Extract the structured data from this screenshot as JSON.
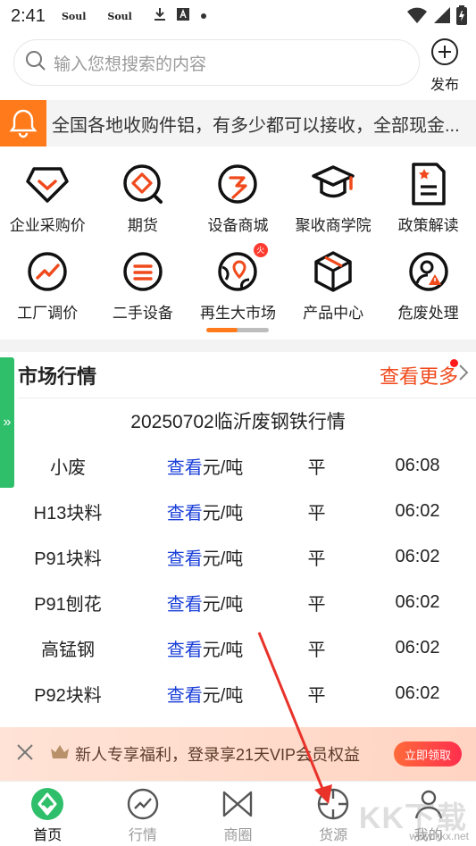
{
  "status_bar": {
    "time": "2:41",
    "app_icons": [
      "Soul",
      "Soul"
    ]
  },
  "search": {
    "placeholder": "输入您想搜索的内容",
    "publish_label": "发布"
  },
  "notice": {
    "text": "全国各地收购件铝，有多少都可以接收，全部现金..."
  },
  "grid": {
    "row1": [
      {
        "label": "企业采购价",
        "icon": "pentagon-check-icon"
      },
      {
        "label": "期货",
        "icon": "diamond-search-icon"
      },
      {
        "label": "设备商城",
        "icon": "bolt-circle-icon"
      },
      {
        "label": "聚收商学院",
        "icon": "graduation-cap-icon"
      },
      {
        "label": "政策解读",
        "icon": "document-star-icon"
      }
    ],
    "row2": [
      {
        "label": "工厂调价",
        "icon": "trend-circle-icon"
      },
      {
        "label": "二手设备",
        "icon": "menu-circle-icon"
      },
      {
        "label": "再生大市场",
        "icon": "map-pin-icon",
        "badge": "火"
      },
      {
        "label": "产品中心",
        "icon": "cube-icon"
      },
      {
        "label": "危废处理",
        "icon": "person-warning-icon"
      }
    ],
    "page_indicator": 0.5
  },
  "market": {
    "title": "市场行情",
    "more_label": "查看更多",
    "subtitle": "20250702临沂废钢铁行情",
    "view_label": "查看",
    "rows": [
      {
        "name": "小废",
        "unit": "元/吨",
        "trend": "平",
        "time": "06:08"
      },
      {
        "name": "H13块料",
        "unit": "元/吨",
        "trend": "平",
        "time": "06:02"
      },
      {
        "name": "P91块料",
        "unit": "元/吨",
        "trend": "平",
        "time": "06:02"
      },
      {
        "name": "P91刨花",
        "unit": "元/吨",
        "trend": "平",
        "time": "06:02"
      },
      {
        "name": "高锰钢",
        "unit": "元/吨",
        "trend": "平",
        "time": "06:02"
      },
      {
        "name": "P92块料",
        "unit": "元/吨",
        "trend": "平",
        "time": "06:02"
      }
    ]
  },
  "promo": {
    "text": "新人专享福利，登录享21天VIP会员权益",
    "button": "立即领取"
  },
  "tabs": [
    {
      "label": "首页",
      "active": true
    },
    {
      "label": "行情",
      "active": false
    },
    {
      "label": "商圈",
      "active": false
    },
    {
      "label": "货源",
      "active": false
    },
    {
      "label": "我的",
      "active": false
    }
  ],
  "watermark": {
    "brand": "KK下载",
    "url": "www.kkx.net"
  },
  "colors": {
    "accent_orange": "#ff7a1a",
    "link_blue": "#1a3fd8",
    "more_red": "#f04a1c",
    "active_green": "#2fbf6a",
    "arrow_red": "#e8322a"
  }
}
